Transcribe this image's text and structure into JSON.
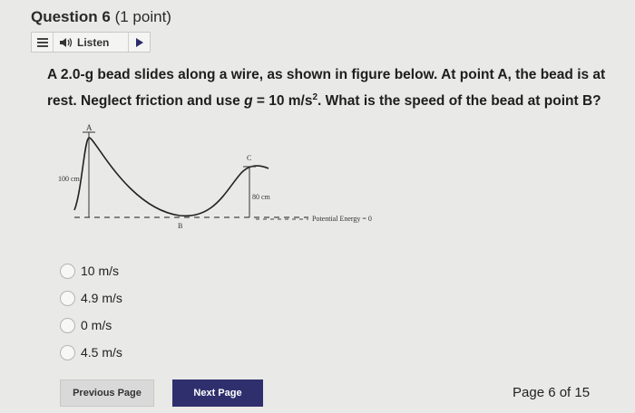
{
  "question": {
    "title": "Question 6",
    "points": "(1 point)",
    "text_part1": "A 2.0-g bead slides along a wire, as shown in figure below. At point A, the bead is at rest. Neglect friction and use ",
    "g_symbol": "g",
    "text_part2": " = 10 m/s",
    "exponent": "2",
    "text_part3": ". What is the speed of the bead at point B?"
  },
  "listen_bar": {
    "label": "Listen",
    "icons": [
      "menu-icon",
      "speaker-icon",
      "play-icon"
    ]
  },
  "figure": {
    "label_a": "A",
    "label_b": "B",
    "label_c": "C",
    "height_a": "100 cm",
    "height_c": "80 cm",
    "pe_label": "Potential Energy = 0"
  },
  "options": [
    {
      "label": "10 m/s"
    },
    {
      "label": "4.9 m/s"
    },
    {
      "label": "0 m/s"
    },
    {
      "label": "4.5 m/s"
    }
  ],
  "navigation": {
    "previous": "Previous Page",
    "next": "Next Page",
    "page_indicator": "Page 6 of 15"
  },
  "colors": {
    "background": "#e9e9e7",
    "next_button": "#2f2f6e",
    "prev_button": "#d9d9d9"
  }
}
